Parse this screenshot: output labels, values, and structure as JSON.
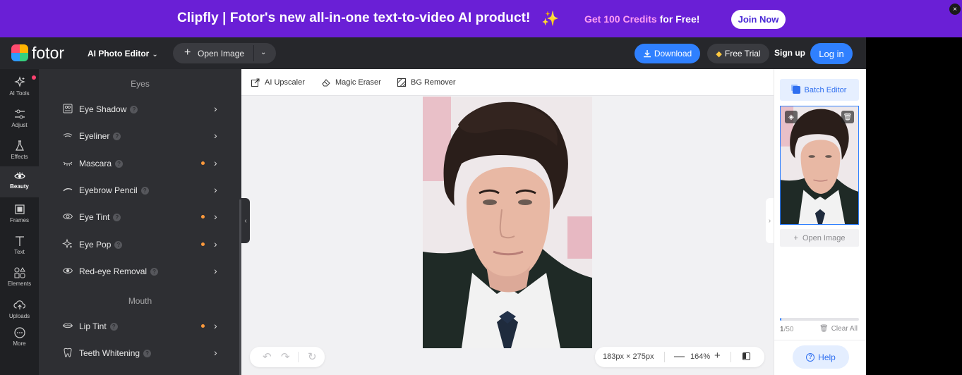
{
  "promo": {
    "headline": "Clipfly | Fotor's new all-in-one text-to-video AI product!",
    "sparkle": "✨",
    "credits_highlight": "Get 100 Credits",
    "credits_rest": " for Free!",
    "join_label": "Join Now",
    "close_glyph": "×"
  },
  "topbar": {
    "logo_text": "fotor",
    "editor_menu": "AI Photo Editor",
    "open_image": "Open Image",
    "download": "Download",
    "free_trial": "Free Trial",
    "sign_up": "Sign up",
    "log_in": "Log in"
  },
  "rail": {
    "items": [
      {
        "label": "AI Tools",
        "icon": "sparkle-icon"
      },
      {
        "label": "Adjust",
        "icon": "sliders-icon"
      },
      {
        "label": "Effects",
        "icon": "flask-icon"
      },
      {
        "label": "Beauty",
        "icon": "eye-icon"
      },
      {
        "label": "Frames",
        "icon": "frame-icon"
      },
      {
        "label": "Text",
        "icon": "text-icon"
      },
      {
        "label": "Elements",
        "icon": "shapes-icon"
      },
      {
        "label": "Uploads",
        "icon": "cloud-upload-icon"
      },
      {
        "label": "More",
        "icon": "more-icon"
      }
    ],
    "active": "Beauty"
  },
  "panel": {
    "sections": [
      {
        "title": "Eyes",
        "tools": [
          {
            "label": "Eye Shadow",
            "premium": false
          },
          {
            "label": "Eyeliner",
            "premium": false
          },
          {
            "label": "Mascara",
            "premium": true
          },
          {
            "label": "Eyebrow Pencil",
            "premium": false
          },
          {
            "label": "Eye Tint",
            "premium": true
          },
          {
            "label": "Eye Pop",
            "premium": true
          },
          {
            "label": "Red-eye Removal",
            "premium": false
          }
        ]
      },
      {
        "title": "Mouth",
        "tools": [
          {
            "label": "Lip Tint",
            "premium": true
          },
          {
            "label": "Teeth Whitening",
            "premium": false
          }
        ]
      }
    ],
    "help_glyph": "?",
    "arrow_glyph": "›"
  },
  "subtoolbar": {
    "ai_upscaler": "AI Upscaler",
    "magic_eraser": "Magic Eraser",
    "bg_remover": "BG Remover"
  },
  "canvas": {
    "image_dims": "183px × 275px",
    "zoom": "164%",
    "minus": "—",
    "plus": "+"
  },
  "right_panel": {
    "batch_editor": "Batch Editor",
    "open_image": "Open Image",
    "count_current": "1",
    "count_total": "/50",
    "progress_fraction": 0.02,
    "clear_all": "Clear All",
    "help": "Help"
  },
  "colors": {
    "promo_bg": "#6a1fd6",
    "accent": "#2f80ff",
    "premium_dot": "#ff9a3c"
  }
}
